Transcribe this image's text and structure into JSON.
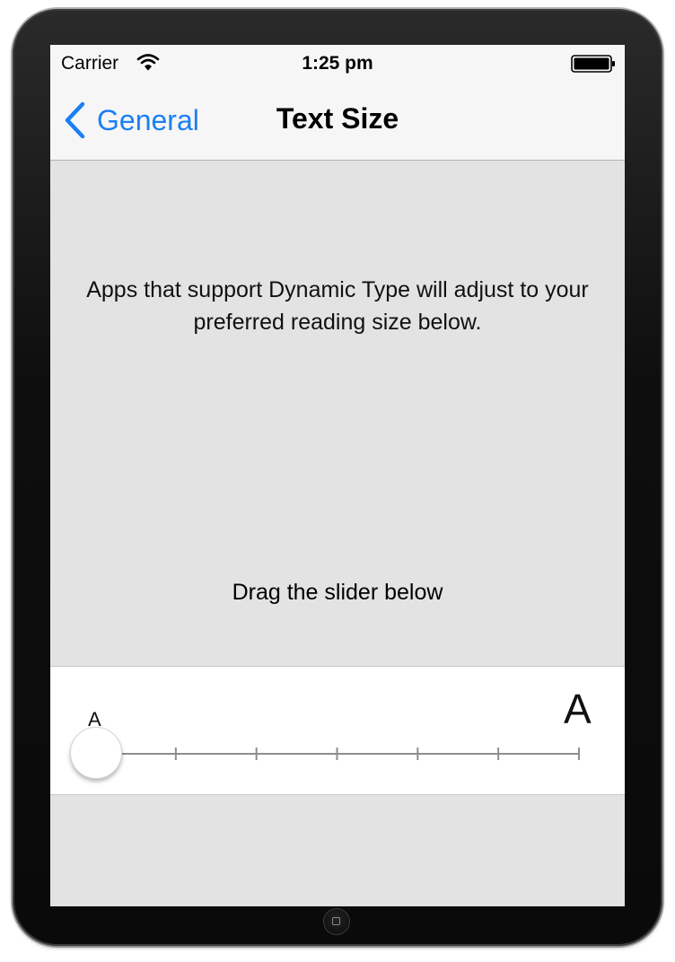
{
  "status_bar": {
    "carrier": "Carrier",
    "time": "1:25 pm",
    "wifi_icon": "wifi-icon",
    "battery_icon": "battery-full-icon"
  },
  "nav_bar": {
    "back_label": "General",
    "back_icon": "chevron-left-icon",
    "title": "Text Size"
  },
  "content": {
    "description": "Apps that support Dynamic Type will adjust to your preferred reading size below.",
    "instruction": "Drag the slider below"
  },
  "slider": {
    "min_label": "A",
    "max_label": "A",
    "steps": 7,
    "value_index": 0
  },
  "colors": {
    "accent": "#1a7ff5",
    "background": "#e3e3e3",
    "bar_background": "#f6f6f6",
    "panel_background": "#ffffff"
  }
}
